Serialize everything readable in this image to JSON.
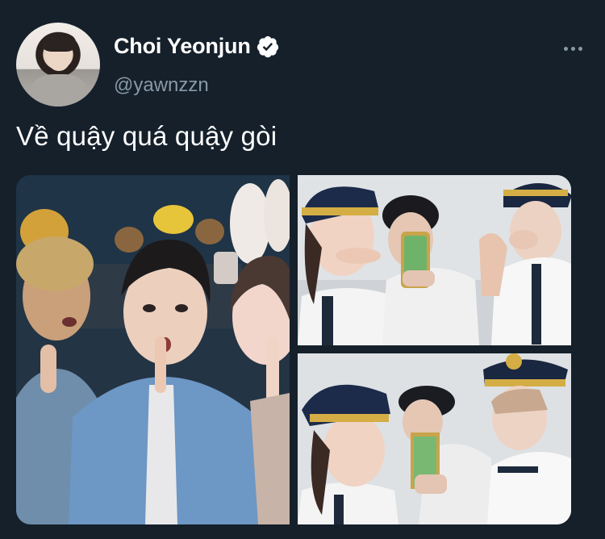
{
  "tweet": {
    "display_name": "Choi Yeonjun",
    "handle": "@yawnzzn",
    "text": "Về quậy quá quậy gòi",
    "verified": true
  },
  "icons": {
    "verified": "verified-badge-icon",
    "more": "more-options-icon"
  },
  "colors": {
    "background": "#15202b",
    "name": "#ffffff",
    "handle": "#8899a6",
    "text": "#ffffff"
  },
  "media": {
    "count": 3,
    "items": [
      {
        "name": "photo-group-selfie"
      },
      {
        "name": "photo-pilot-uniform-selfie-1"
      },
      {
        "name": "photo-pilot-uniform-selfie-2"
      }
    ]
  }
}
